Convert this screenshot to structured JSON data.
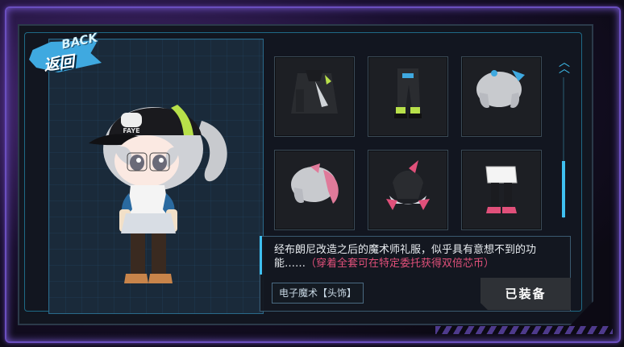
{
  "back_button": {
    "label_en": "BACK",
    "label_cn": "返回"
  },
  "character": {
    "cap_text": "FAYE"
  },
  "items": [
    {
      "name": "jacket-item"
    },
    {
      "name": "pants-item"
    },
    {
      "name": "hair-gray-item"
    },
    {
      "name": "hair-pink-item"
    },
    {
      "name": "headpiece-item"
    },
    {
      "name": "boots-item"
    }
  ],
  "description": {
    "main": "经布朗尼改造之后的魔术师礼服，似乎具有意想不到的功能……",
    "hint": "（穿着全套可在特定委托获得双倍芯币）"
  },
  "item_tag": "电子魔术【头饰】",
  "equip_button": "已装备",
  "colors": {
    "accent": "#3fc0f0",
    "hint": "#e0507a",
    "frame": "#6a4fbf"
  }
}
